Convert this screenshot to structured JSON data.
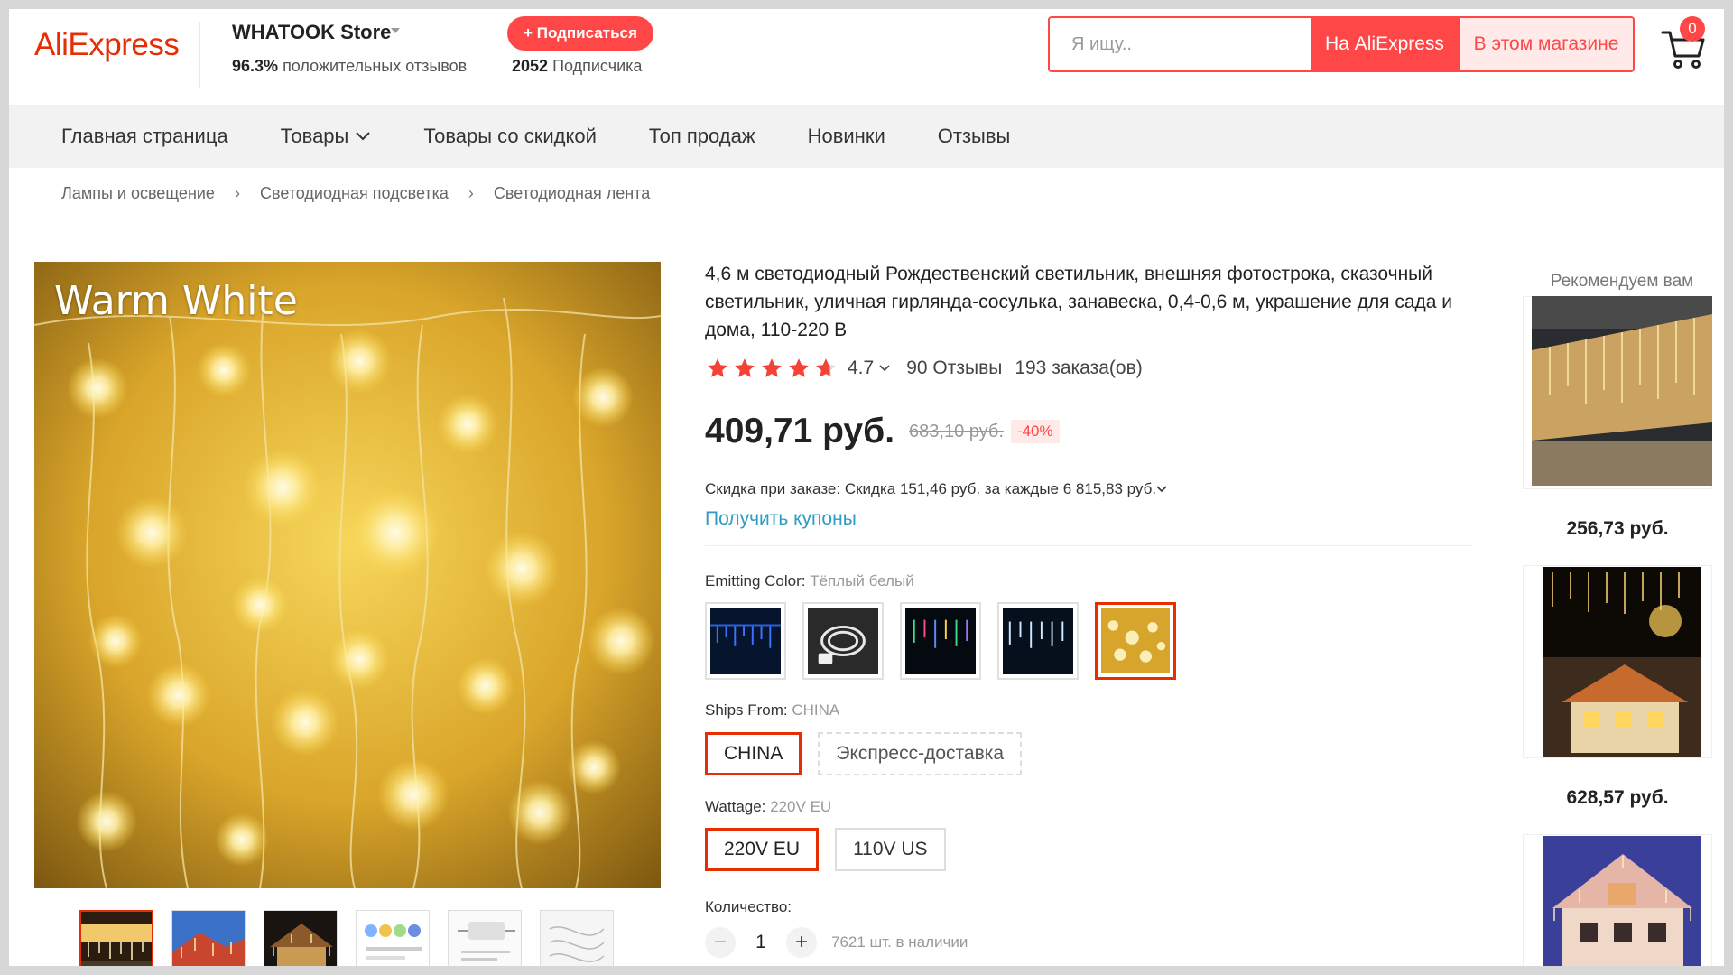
{
  "header": {
    "logo": "AliExpress",
    "store_name": "WHATOOK Store",
    "rating_percent": "96.3%",
    "rating_text": "положительных отзывов",
    "subscribe_label": "+ Подписаться",
    "followers_count": "2052",
    "followers_text": "Подписчика",
    "search_placeholder": "Я ищу..",
    "search_ali_label": "На AliExpress",
    "search_store_label": "В этом магазине",
    "cart_count": "0"
  },
  "nav": {
    "items": [
      {
        "label": "Главная страница"
      },
      {
        "label": "Товары"
      },
      {
        "label": "Товары со скидкой"
      },
      {
        "label": "Топ продаж"
      },
      {
        "label": "Новинки"
      },
      {
        "label": "Отзывы"
      }
    ]
  },
  "breadcrumb": [
    "Лампы и освещение",
    "Светодиодная подсветка",
    "Светодиодная лента"
  ],
  "gallery": {
    "overlay_text": "Warm White",
    "thumbnail_count": 6,
    "active_thumbnail": 1
  },
  "product": {
    "title": "4,6 м светодиодный Рождественский светильник, внешняя фотострока, сказочный светильник, уличная гирлянда-сосулька, занавеска, 0,4-0,6 м, украшение для сада и дома, 110-220 В",
    "rating": "4.7",
    "rating_stars": 4.7,
    "reviews": "90 Отзывы",
    "orders": "193 заказа(ов)",
    "price": "409,71 руб.",
    "old_price": "683,10 руб.",
    "discount": "-40%",
    "order_discount": "Скидка при заказе: Скидка 151,46 руб. за каждые 6 815,83 руб.",
    "coupons": "Получить купоны"
  },
  "options": {
    "color_label": "Emitting Color:",
    "color_value": "Тёплый белый",
    "color_swatches": [
      "blue-icicle",
      "controller-cable",
      "multicolor-icicle",
      "white-icicle",
      "warm-white"
    ],
    "ships_label": "Ships From:",
    "ships_value": "CHINA",
    "ships_options": [
      "CHINA",
      "Экспресс-доставка"
    ],
    "wattage_label": "Wattage:",
    "wattage_value": "220V EU",
    "wattage_options": [
      "220V EU",
      "110V US"
    ],
    "quantity_label": "Количество:",
    "quantity_minus": "−",
    "quantity_plus": "+",
    "quantity": "1",
    "stock": "7621 шт. в наличии"
  },
  "recommend": {
    "title": "Рекомендуем вам",
    "items": [
      {
        "price": "256,73 руб."
      },
      {
        "price": "628,57 руб."
      },
      {
        "price": ""
      }
    ]
  },
  "colors": {
    "accent": "#ff4747",
    "brand": "#e62e04",
    "link": "#2e9cc3",
    "star": "#f44336"
  }
}
